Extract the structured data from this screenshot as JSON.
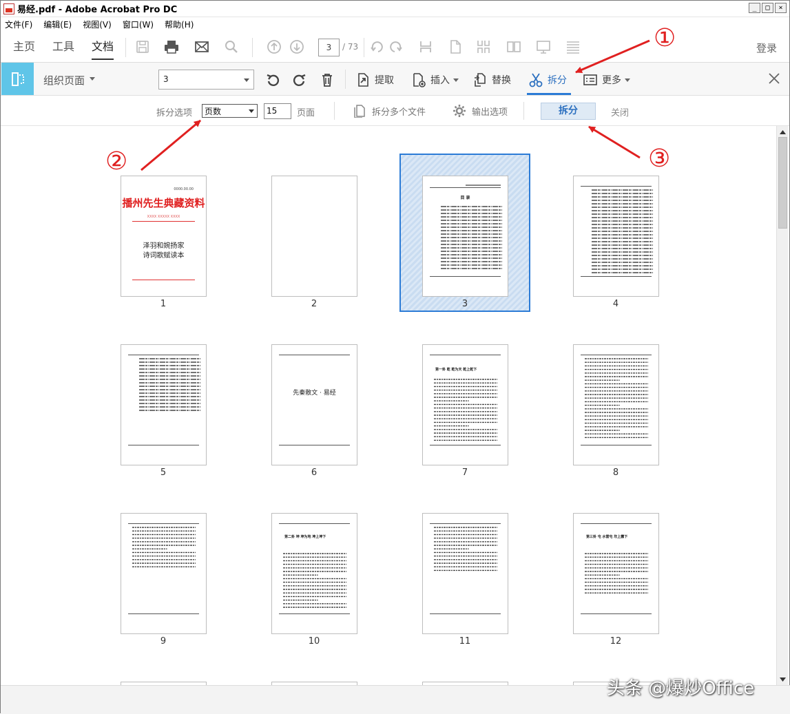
{
  "window": {
    "title": "易经.pdf - Adobe Acrobat Pro DC",
    "controls": [
      "_",
      "□",
      "×"
    ]
  },
  "menu": [
    "文件(F)",
    "编辑(E)",
    "视图(V)",
    "窗口(W)",
    "帮助(H)"
  ],
  "main_toolbar": {
    "tabs": [
      "主页",
      "工具",
      "文档"
    ],
    "active_tab": "文档",
    "page_current": "3",
    "page_total": "/ 73",
    "login": "登录"
  },
  "organize_bar": {
    "label": "组织页面",
    "select_value": "3",
    "extract": "提取",
    "insert": "插入",
    "replace": "替换",
    "split": "拆分",
    "more": "更多"
  },
  "split_bar": {
    "options_label": "拆分选项",
    "select_value": "页数",
    "count_value": "15",
    "pages_label": "页面",
    "split_multiple": "拆分多个文件",
    "output_options": "输出选项",
    "split_button": "拆分",
    "close": "关闭"
  },
  "thumbnails": [
    {
      "num": "1",
      "kind": "cover",
      "code": "0000.00.00",
      "title": "播州先生典藏资料",
      "subline": "XXXX  XXXXX  XXXX",
      "body1": "泽羽和婉扬家",
      "body2": "诗词歌赋读本"
    },
    {
      "num": "2",
      "kind": "blank"
    },
    {
      "num": "3",
      "kind": "toc",
      "heading": "目  录",
      "selected": true
    },
    {
      "num": "4",
      "kind": "toc-cont"
    },
    {
      "num": "5",
      "kind": "toc-cont-short"
    },
    {
      "num": "6",
      "kind": "section",
      "heading": "先秦散文 · 易经"
    },
    {
      "num": "7",
      "kind": "chapter",
      "heading": "第一卦  乾  乾为天  乾上乾下"
    },
    {
      "num": "8",
      "kind": "text"
    },
    {
      "num": "9",
      "kind": "text-short"
    },
    {
      "num": "10",
      "kind": "chapter",
      "heading": "第二卦  坤  坤为地  坤上坤下"
    },
    {
      "num": "11",
      "kind": "text-mid"
    },
    {
      "num": "12",
      "kind": "chapter",
      "heading": "第三卦  屯  水雷屯  坎上震下"
    }
  ],
  "annotations": [
    "①",
    "②",
    "③"
  ],
  "watermark": "头条 @爆炒Office"
}
